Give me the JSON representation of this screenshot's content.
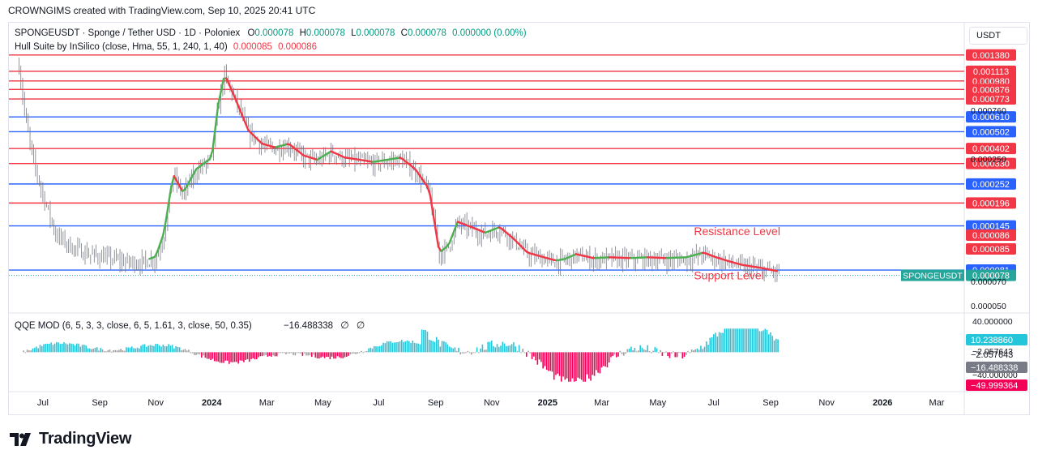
{
  "header": {
    "attribution": "CROWNGIMS created with TradingView.com, Sep 10, 2025 20:41 UTC"
  },
  "legend": {
    "symbol_line": "SPONGEUSDT · Sponge / Tether USD · 1D · Poloniex",
    "o_label": "O",
    "o_value": "0.000078",
    "h_label": "H",
    "h_value": "0.000078",
    "l_label": "L",
    "l_value": "0.000078",
    "c_label": "C",
    "c_value": "0.000078",
    "change": "0.000000 (0.00%)",
    "indicator_name": "Hull Suite by InSilico (close, Hma, 55, 1, 240, 1, 40)",
    "indicator_v1": "0.000085",
    "indicator_v2": "0.000086"
  },
  "oscillator_legend": {
    "name": "QQE MOD (6, 5, 3, 3, close, 6, 5, 1.61, 3, close, 50, 0.35)",
    "value": "−16.488338",
    "icons": [
      "empty-set-icon",
      "empty-set-icon"
    ],
    "icon_glyph": "∅"
  },
  "currency": "USDT",
  "brand": {
    "name": "TradingView"
  },
  "colors": {
    "red": "#f23645",
    "blue": "#2962ff",
    "hull_up": "#4caf50",
    "hull_down": "#f23645",
    "qqe_up": "#26c6da",
    "qqe_dn": "#f50057",
    "neutral": "#9e9e9e",
    "candle": "#787b86"
  },
  "chart_data": {
    "type": "candlestick",
    "price_panel": {
      "y_scale": "log",
      "ylim": [
        4.8e-05,
        0.0015
      ],
      "axis_ticks": [
        "0.000050",
        "0.000070",
        "0.000760",
        "0.000250"
      ],
      "close_trajectory": {
        "dates": [
          "2023-06-05",
          "2023-06-12",
          "2023-06-20",
          "2023-07-01",
          "2023-07-15",
          "2023-08-01",
          "2023-08-20",
          "2023-09-10",
          "2023-10-01",
          "2023-10-20",
          "2023-11-01",
          "2023-11-10",
          "2023-11-20",
          "2023-12-01",
          "2023-12-15",
          "2024-01-01",
          "2024-01-08",
          "2024-01-15",
          "2024-01-25",
          "2024-02-10",
          "2024-02-25",
          "2024-03-10",
          "2024-03-25",
          "2024-04-10",
          "2024-04-25",
          "2024-05-10",
          "2024-05-25",
          "2024-06-10",
          "2024-06-25",
          "2024-07-10",
          "2024-07-25",
          "2024-08-10",
          "2024-08-25",
          "2024-09-05",
          "2024-09-15",
          "2024-09-25",
          "2024-10-10",
          "2024-10-25",
          "2024-11-10",
          "2024-11-25",
          "2024-12-10",
          "2024-12-25",
          "2025-01-10",
          "2025-01-20",
          "2025-02-01",
          "2025-02-20",
          "2025-03-10",
          "2025-04-01",
          "2025-04-20",
          "2025-05-10",
          "2025-06-01",
          "2025-06-20",
          "2025-07-01",
          "2025-07-15",
          "2025-08-01",
          "2025-08-20",
          "2025-09-10"
        ],
        "values": [
          0.0012,
          0.0006,
          0.00035,
          0.00022,
          0.00013,
          0.00011,
          0.0001,
          9.5e-05,
          9e-05,
          9e-05,
          9.5e-05,
          0.00013,
          0.00028,
          0.00022,
          0.0003,
          0.00035,
          0.0007,
          0.00105,
          0.0008,
          0.0005,
          0.00042,
          0.0004,
          0.00042,
          0.00036,
          0.00034,
          0.00038,
          0.00035,
          0.00034,
          0.00033,
          0.00034,
          0.00035,
          0.0003,
          0.00023,
          0.0001,
          0.00011,
          0.00015,
          0.00014,
          0.00013,
          0.00014,
          0.00012,
          0.0001,
          9.5e-05,
          9e-05,
          9.2e-05,
          9.8e-05,
          9.3e-05,
          9.4e-05,
          9.3e-05,
          9.4e-05,
          9.3e-05,
          9.4e-05,
          0.0001,
          9.5e-05,
          9e-05,
          8.5e-05,
          8.2e-05,
          7.8e-05
        ]
      },
      "hull_suite": {
        "legend_values": [
          8.5e-05,
          8.6e-05
        ],
        "colors": {
          "up": "#4caf50",
          "down": "#f23645"
        }
      },
      "current_price": {
        "label": "SPONGEUSDT",
        "value": "0.000078"
      },
      "horizontal_levels": [
        {
          "value": "0.001380",
          "color": "#f23645"
        },
        {
          "value": "0.001113",
          "color": "#f23645"
        },
        {
          "value": "0.000980",
          "color": "#f23645"
        },
        {
          "value": "0.000876",
          "color": "#f23645"
        },
        {
          "value": "0.000773",
          "color": "#f23645"
        },
        {
          "value": "0.000610",
          "color": "#2962ff"
        },
        {
          "value": "0.000502",
          "color": "#2962ff"
        },
        {
          "value": "0.000402",
          "color": "#f23645"
        },
        {
          "value": "0.000330",
          "color": "#f23645"
        },
        {
          "value": "0.000252",
          "color": "#2962ff"
        },
        {
          "value": "0.000196",
          "color": "#f23645"
        },
        {
          "value": "0.000145",
          "color": "#2962ff"
        },
        {
          "value": "0.000081",
          "color": "#2962ff"
        }
      ],
      "value_tags": [
        {
          "value": "0.000086",
          "color": "#f23645"
        },
        {
          "value": "0.000085",
          "color": "#f23645"
        }
      ],
      "annotations": [
        {
          "text": "Resistance Level",
          "date": "2025-06-20",
          "value": 0.000128,
          "color": "#f23645"
        },
        {
          "text": "Support Level",
          "date": "2025-06-20",
          "value": 7.15e-05,
          "color": "#f23645"
        }
      ]
    },
    "oscillator_panel": {
      "name": "QQE MOD",
      "ylim": [
        -60,
        50
      ],
      "axis_ticks": [
        "40.000000",
        "−2.057643",
        "−40.000000"
      ],
      "tags": [
        {
          "value": "10.238860",
          "color": "#26c6da"
        },
        {
          "value": "−2.057643",
          "color": "none"
        },
        {
          "value": "−16.488338",
          "color": "#787b86"
        },
        {
          "value": "−49.999364",
          "color": "#f50057"
        }
      ]
    },
    "x_axis": {
      "range": [
        "2023-05-25",
        "2026-03-31"
      ],
      "ticks": [
        {
          "date": "2023-07-01",
          "label": "Jul",
          "bold": false
        },
        {
          "date": "2023-09-01",
          "label": "Sep",
          "bold": false
        },
        {
          "date": "2023-11-01",
          "label": "Nov",
          "bold": false
        },
        {
          "date": "2024-01-01",
          "label": "2024",
          "bold": true
        },
        {
          "date": "2024-03-01",
          "label": "Mar",
          "bold": false
        },
        {
          "date": "2024-05-01",
          "label": "May",
          "bold": false
        },
        {
          "date": "2024-07-01",
          "label": "Jul",
          "bold": false
        },
        {
          "date": "2024-09-01",
          "label": "Sep",
          "bold": false
        },
        {
          "date": "2024-11-01",
          "label": "Nov",
          "bold": false
        },
        {
          "date": "2025-01-01",
          "label": "2025",
          "bold": true
        },
        {
          "date": "2025-03-01",
          "label": "Mar",
          "bold": false
        },
        {
          "date": "2025-05-01",
          "label": "May",
          "bold": false
        },
        {
          "date": "2025-07-01",
          "label": "Jul",
          "bold": false
        },
        {
          "date": "2025-09-01",
          "label": "Sep",
          "bold": false
        },
        {
          "date": "2025-11-01",
          "label": "Nov",
          "bold": false
        },
        {
          "date": "2026-01-01",
          "label": "2026",
          "bold": true
        },
        {
          "date": "2026-03-01",
          "label": "Mar",
          "bold": false
        }
      ]
    }
  }
}
